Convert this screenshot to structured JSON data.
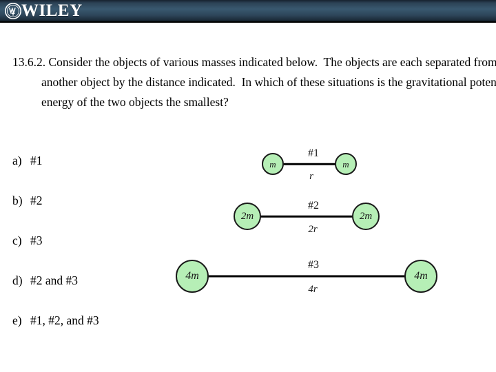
{
  "header": {
    "brand_name": "WILEY",
    "logo_icon": "wiley-monogram-icon",
    "bar_color": "#2c4356"
  },
  "question": {
    "number": "13.6.2.",
    "text": "13.6.2. Consider the objects of various masses indicated below.  The objects are each separated from another object by the distance indicated.  In which of these situations is the gravitational potential energy of the two objects the smallest?"
  },
  "options": [
    {
      "letter": "a)",
      "text": "#1"
    },
    {
      "letter": "b)",
      "text": "#2"
    },
    {
      "letter": "c)",
      "text": "#3"
    },
    {
      "letter": "d)",
      "text": "#2 and #3"
    },
    {
      "letter": "e)",
      "text": "#1, #2, and #3"
    }
  ],
  "diagrams": [
    {
      "id": "#1",
      "top_label": "#1",
      "bottom_label": "r",
      "left_mass": "m",
      "right_mass": "m",
      "mass_color": "#b6efb6"
    },
    {
      "id": "#2",
      "top_label": "#2",
      "bottom_label": "2r",
      "left_mass": "2m",
      "right_mass": "2m",
      "mass_color": "#b6efb6"
    },
    {
      "id": "#3",
      "top_label": "#3",
      "bottom_label": "4r",
      "left_mass": "4m",
      "right_mass": "4m",
      "mass_color": "#b6efb6"
    }
  ]
}
